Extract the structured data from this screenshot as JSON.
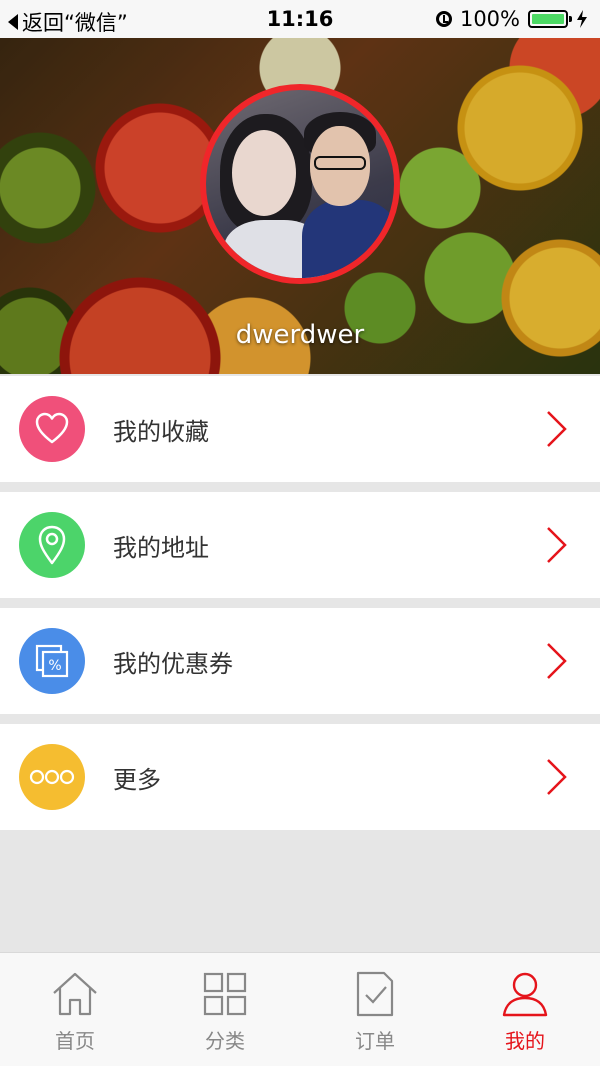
{
  "status_bar": {
    "back_label": "返回“微信”",
    "time": "11:16",
    "battery_percent": "100%",
    "battery_level": 1.0
  },
  "profile": {
    "username": "dwerdwer"
  },
  "menu": {
    "items": [
      {
        "label": "我的收藏",
        "icon": "heart-icon",
        "color": "#f0507a"
      },
      {
        "label": "我的地址",
        "icon": "location-pin-icon",
        "color": "#4cd46a"
      },
      {
        "label": "我的优惠券",
        "icon": "coupon-icon",
        "color": "#4a8de8"
      },
      {
        "label": "更多",
        "icon": "more-dots-icon",
        "color": "#f5bd30"
      }
    ],
    "chevron_color": "#e5141b"
  },
  "tabbar": {
    "tabs": [
      {
        "label": "首页",
        "icon": "home-icon"
      },
      {
        "label": "分类",
        "icon": "grid-icon"
      },
      {
        "label": "订单",
        "icon": "order-icon"
      },
      {
        "label": "我的",
        "icon": "user-icon"
      }
    ],
    "active_index": 3,
    "active_color": "#e5141b"
  }
}
